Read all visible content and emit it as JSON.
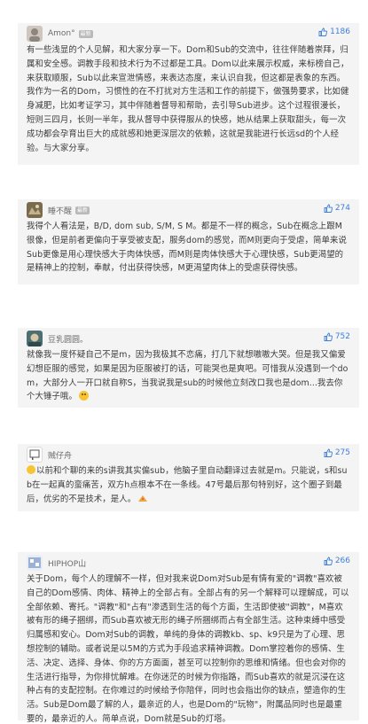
{
  "comments": [
    {
      "username": "Amon°",
      "badge": "最新",
      "likes": "1186",
      "text": "有一些浅显的个人见解，和大家分享一下。Dom和Sub的交流中，往往伴随着崇拜，归属和安全感。调教手段和技术行为不过都是工具。Dom以此来展示权威，来标榜自己，来获取顺服，Sub以此来宣泄情感，来表达态度，来认识自我，但这都是表象的东西。我作为一名的Dom，习惯性的在不打扰对方生活和工作的前提下，做强势要求，比如健身减肥，比如考证学习，其中伴随着督导和帮助，去引导Sub进步。这个过程很漫长，短则三四月，长则一半年，我从督导中获得服从的快感，她从结果上获取甜头，每一次成功都会孕育出巨大的成就感和她更深层次的依赖，这就是我能进行长远sd的个人经验。与大家分享。"
    },
    {
      "username": "睡不醒",
      "badge": "最新",
      "likes": "274",
      "text": "我得个人看法是，B/D, dom sub,  S/M,  S M。都是不一样的概念，Sub在概念上跟M很像，但是前者更偏向于享受被支配，服务dom的感觉，而M则更向于受虐，简单来说Sub更像是用心理快感大于肉体快感，而M则是肉体快感大于心理快感，Sub更渴望的是精神上的控制，奉献，付出获得快感，M更渴望肉体上的受虐获得快感。"
    },
    {
      "username": "豆乳圆圆。",
      "likes": "752",
      "text": "就像我一度怀疑自己不是m，因为我极其不恋痛，打几下就想嗷嗷大哭。但是我又偏爱幻想臣服的感觉，如果是因为臣服被打的话，可能哭也是爽吧。可惜我从没遇到一个dom，大部分人一开口就自称S，当我说我是sub的时候他立刻改口我也是dom...我去你个大锤子哦。"
    },
    {
      "username": "贼仔舟",
      "likes": "275",
      "text": "以前和个聊的来的s讲我其实偏sub，他脑子里自动翻译过去就是m。只能说，s和sub在一起真的蛮痛苦，双方h点根本不在一条线。47号最后那句特别好，这个圈子到最后，优劣的不是技术，是人。"
    },
    {
      "username": "HIPHOP山",
      "likes": "266",
      "text": "关于Dom，每个人的理解不一样，但对我来说Dom对Sub是有情有爱的\"调教\"喜欢被自己的Dom感情、肉体、精神上的全部占有。全部占有的另一个解释可以理解成，可以全部依赖、寄托。\"调教\"和\"占有\"渗透到生活的每个方面，生活即使被\"调教\"，M喜欢被有形的绳子捆绑，而Sub喜欢被无形的绳子所捆绑而占有全部生活。这种束缚中感受归属感和安心。Dom对Sub的调教，单纯的身体的调教kb、sp、k9只是为了心理、思想控制的辅助。或者说是以5M的方式为手段追求精神调教。Dom掌控着你的感情、生活、决定、选择、身体、你的方方面面，甚至可以控制你的思维和情绪。但也会对你的生活进行指导，为你排忧解难。在你迷茫的时候为你指路，而Sub喜欢的就是沉浸在这种占有的支配控制。在你难过的时候给予你陪伴，同时也会指出你的缺点，塑造你的生活。Sub是Dom最了解的人，最亲近的人，也是Dom的\"玩物\"，附属品同时也是最重要的，最亲近的人。简单点说，Dom就是Sub的灯塔。"
    }
  ]
}
